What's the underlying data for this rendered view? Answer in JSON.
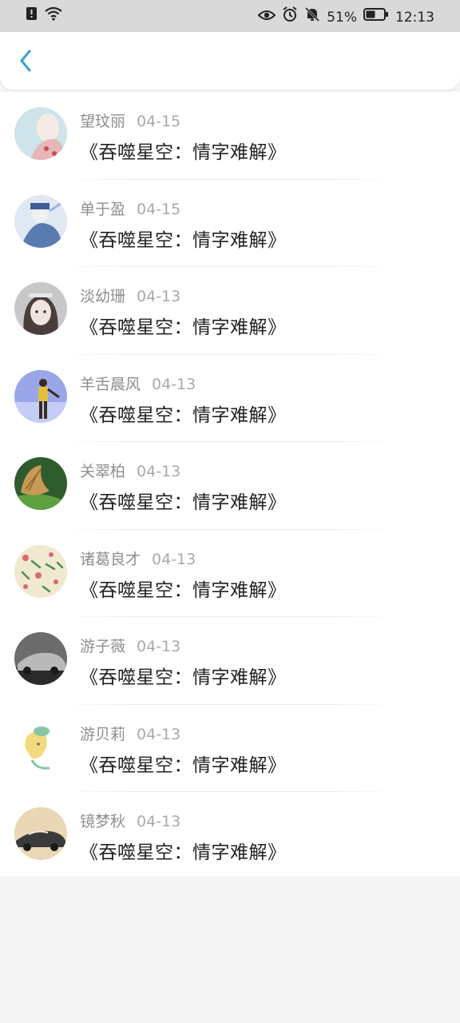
{
  "status_bar": {
    "battery_percent": "51%",
    "time": "12:13",
    "icons": [
      "alert-icon",
      "wifi-icon",
      "eye-icon",
      "alarm-icon",
      "mute-icon",
      "battery-icon"
    ]
  },
  "header": {
    "back_icon": "chevron-left-icon",
    "accent_color": "#3a9fd8"
  },
  "list": {
    "items": [
      {
        "name": "望玟丽",
        "date": "04-15",
        "title": "《吞噬星空：情字难解》",
        "avatar_colors": [
          "#cfe3ea",
          "#e7b6b8",
          "#f4ece4"
        ]
      },
      {
        "name": "单于盈",
        "date": "04-15",
        "title": "《吞噬星空：情字难解》",
        "avatar_colors": [
          "#dfe8f3",
          "#5a7bb0",
          "#f0f0f0"
        ]
      },
      {
        "name": "淡幼珊",
        "date": "04-13",
        "title": "《吞噬星空：情字难解》",
        "avatar_colors": [
          "#c8c8c8",
          "#4a3e3c",
          "#f1e3df"
        ]
      },
      {
        "name": "羊舌晨风",
        "date": "04-13",
        "title": "《吞噬星空：情字难解》",
        "avatar_colors": [
          "#9aa6e8",
          "#c4cdf5",
          "#3a2a22"
        ]
      },
      {
        "name": "关翠柏",
        "date": "04-13",
        "title": "《吞噬星空：情字难解》",
        "avatar_colors": [
          "#2f5c2e",
          "#c79a55",
          "#5fa040"
        ]
      },
      {
        "name": "诸葛良才",
        "date": "04-13",
        "title": "《吞噬星空：情字难解》",
        "avatar_colors": [
          "#f1e9cf",
          "#d46c6c",
          "#4d8c55"
        ]
      },
      {
        "name": "游子薇",
        "date": "04-13",
        "title": "《吞噬星空：情字难解》",
        "avatar_colors": [
          "#6c6c6c",
          "#b9b9b9",
          "#2a2a2a"
        ]
      },
      {
        "name": "游贝莉",
        "date": "04-13",
        "title": "《吞噬星空：情字难解》",
        "avatar_colors": [
          "#ffffff",
          "#f2d97e",
          "#88c6a3"
        ]
      },
      {
        "name": "镜梦秋",
        "date": "04-13",
        "title": "《吞噬星空：情字难解》",
        "avatar_colors": [
          "#e9d7b5",
          "#3a3a3a",
          "#f3e9d8"
        ]
      }
    ]
  }
}
